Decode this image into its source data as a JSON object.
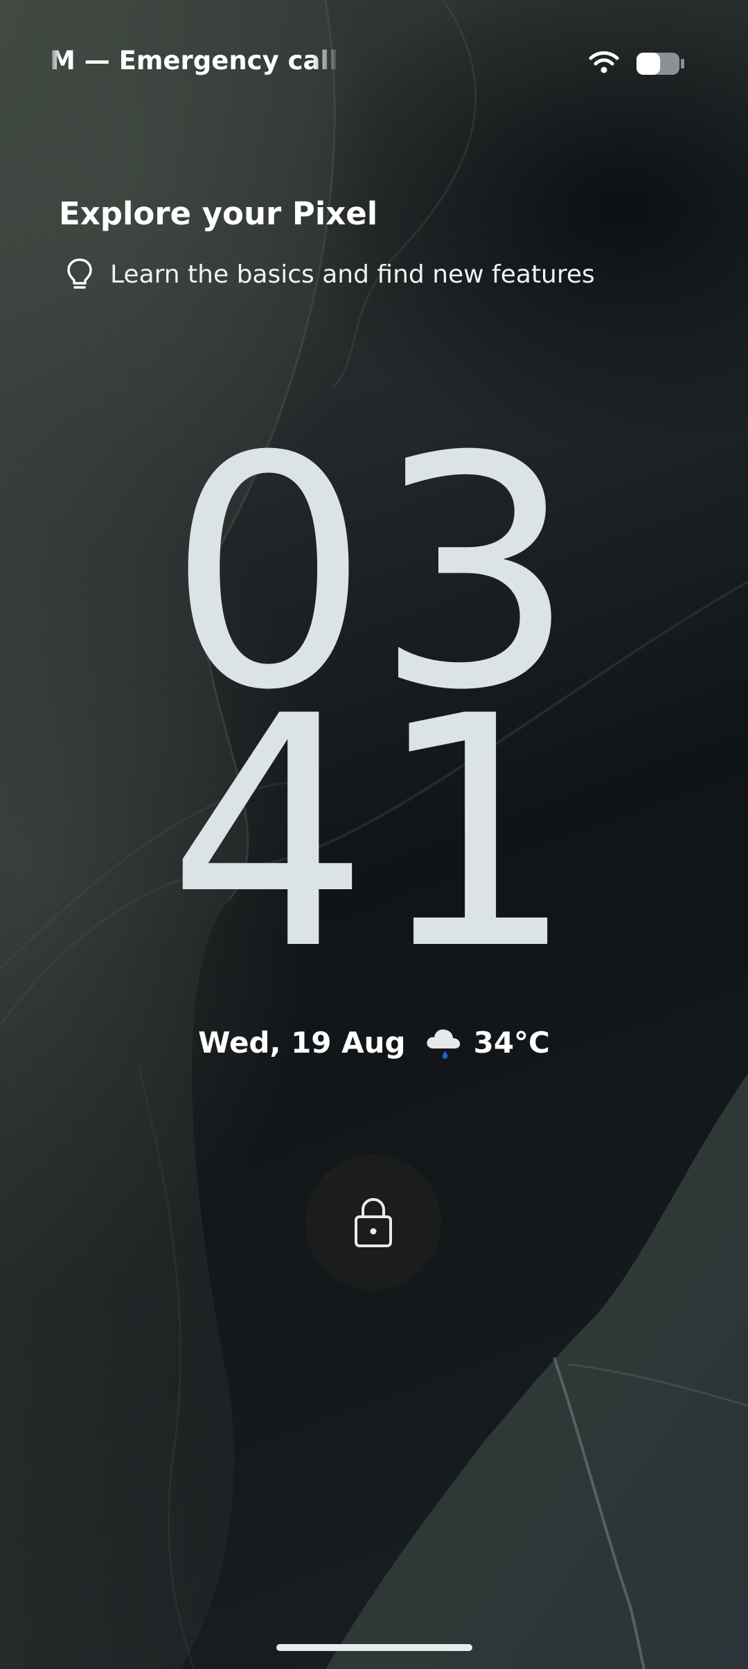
{
  "status_bar": {
    "carrier_text": "M — Emergency calls o",
    "wifi_icon": "wifi-icon",
    "battery_icon": "battery-icon",
    "battery_level": 0.55
  },
  "tip": {
    "title": "Explore your Pixel",
    "subtitle": "Learn the basics and find new features",
    "icon": "lightbulb-icon"
  },
  "clock": {
    "hours": "03",
    "minutes": "41",
    "color": "#dce3e7"
  },
  "date_weather": {
    "date": "Wed, 19 Aug",
    "weather_icon": "cloud-rain-icon",
    "temperature": "34°C"
  },
  "lock": {
    "icon": "lock-icon"
  },
  "colors": {
    "text": "#ffffff",
    "lock_button_bg": "#1b1d1d",
    "home_indicator": "#e9ecee"
  }
}
